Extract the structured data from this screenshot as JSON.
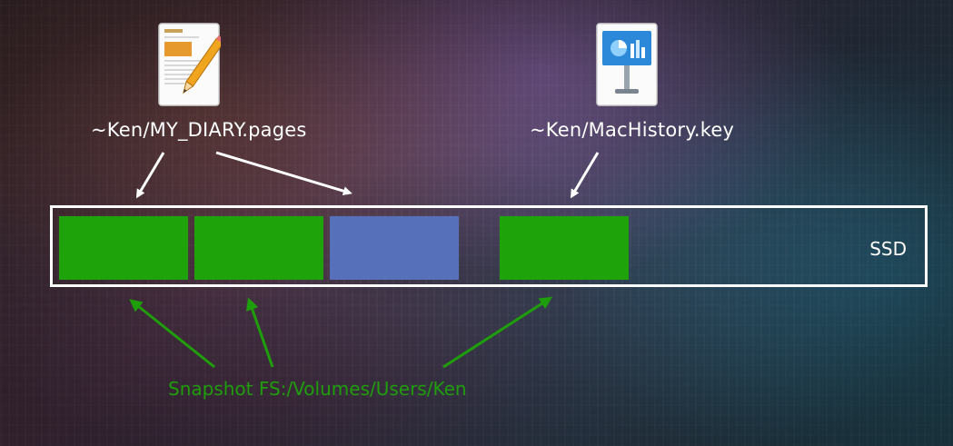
{
  "files": [
    {
      "label": "~Ken/MY_DIARY.pages",
      "icon": "pages-document-icon"
    },
    {
      "label": "~Ken/MacHistory.key",
      "icon": "keynote-document-icon"
    }
  ],
  "disk": {
    "label": "SSD",
    "blocks": [
      {
        "state": "snapshot-shared",
        "color": "#1fa30b"
      },
      {
        "state": "snapshot-shared",
        "color": "#1fa30b"
      },
      {
        "state": "new-write",
        "color": "#5670b9"
      },
      {
        "state": "empty",
        "color": ""
      },
      {
        "state": "snapshot-shared",
        "color": "#1fa30b"
      }
    ]
  },
  "snapshot": {
    "label": "Snapshot FS:/Volumes/Users/Ken",
    "color": "#1f9e0c"
  },
  "colors": {
    "arrow_file": "#ffffff",
    "arrow_snapshot": "#1f9e0c",
    "border": "#ffffff"
  }
}
